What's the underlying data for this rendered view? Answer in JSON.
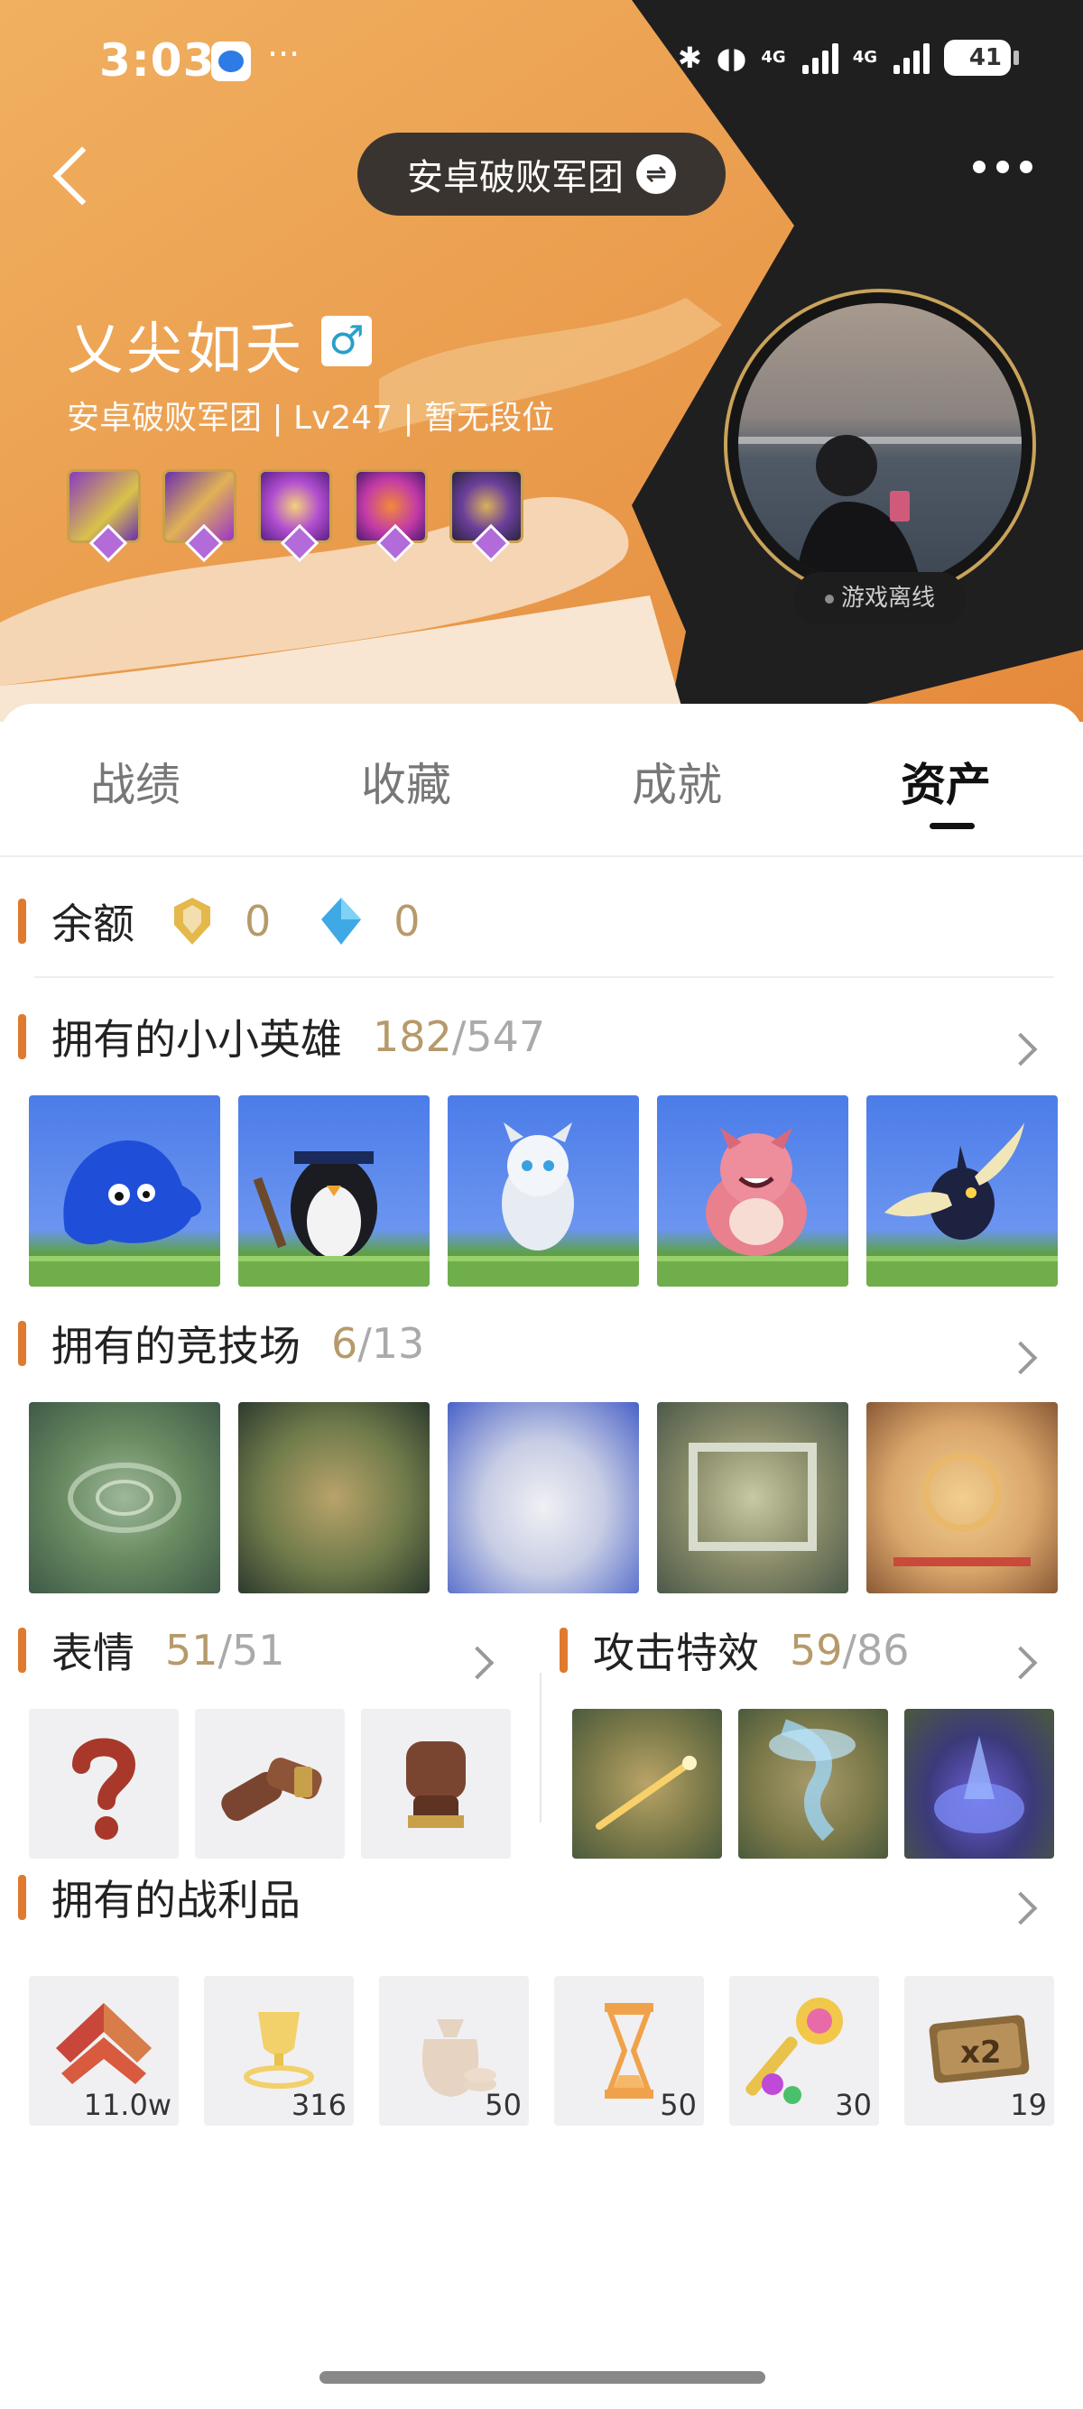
{
  "status_bar": {
    "time": "3:03",
    "dots": "···",
    "net1": "4G",
    "net2": "4G",
    "battery": "41"
  },
  "header": {
    "group_name": "安卓破败军团",
    "swap_icon": "⇌"
  },
  "profile": {
    "nickname": "乂尖如夭",
    "gender_symbol": "♂",
    "subline": "安卓破败军团 | Lv247 | 暂无段位",
    "online_status": "游戏离线",
    "badge_colors": [
      "#6b2fb0",
      "#8a3bbd",
      "#9b34c9",
      "#7d2aa8",
      "#3a2e56"
    ]
  },
  "tabs": [
    {
      "label": "战绩"
    },
    {
      "label": "收藏"
    },
    {
      "label": "成就"
    },
    {
      "label": "资产"
    }
  ],
  "balance": {
    "label": "余额",
    "gold": "0",
    "gem": "0"
  },
  "little_legends": {
    "title": "拥有的小小英雄",
    "owned": "182",
    "total": "/547"
  },
  "arenas": {
    "title": "拥有的竞技场",
    "owned": "6",
    "total": "/13"
  },
  "emotes": {
    "title": "表情",
    "owned": "51",
    "total": "/51"
  },
  "attack_effects": {
    "title": "攻击特效",
    "owned": "59",
    "total": "/86"
  },
  "loot": {
    "title": "拥有的战利品",
    "items": [
      {
        "icon": "rank-chevron-icon",
        "count": "11.0w"
      },
      {
        "icon": "gold-trophy-icon",
        "count": "316"
      },
      {
        "icon": "coin-bag-icon",
        "count": "50"
      },
      {
        "icon": "hourglass-icon",
        "count": "50"
      },
      {
        "icon": "magic-wand-icon",
        "count": "30"
      },
      {
        "icon": "double-ticket-icon",
        "count": "19"
      }
    ]
  },
  "colors": {
    "accent": "#e07a2e",
    "count": "#b69a6a",
    "header": "#e9a14d"
  }
}
